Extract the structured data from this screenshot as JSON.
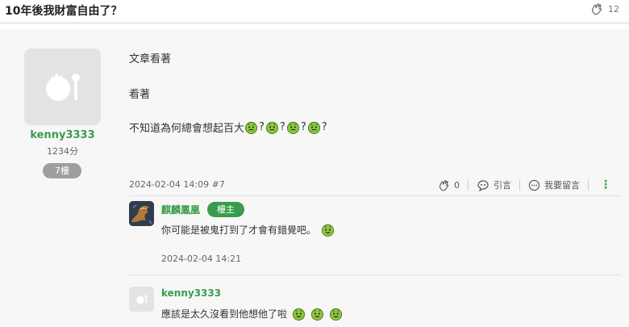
{
  "header": {
    "title": "10年後我財富自由了？",
    "like_count": "12"
  },
  "post": {
    "author": {
      "name": "kenny3333",
      "points": "1234分",
      "floor": "7樓"
    },
    "lines": {
      "line1": "文章看著",
      "line2": "看著",
      "line3": "不知道為何總會想起百大",
      "qmark": "?"
    },
    "date": "2024-02-04 14:09 #7",
    "actions": {
      "like_count": "0",
      "quote_label": "引言",
      "comment_label": "我要留言"
    }
  },
  "comments": [
    {
      "name": "麒麟鳳凰",
      "op_badge": "樓主",
      "text": "你可能是被鬼打到了才會有錯覺吧。",
      "time": "2024-02-04 14:21"
    },
    {
      "name": "kenny3333",
      "text": "應該是太久沒看到他想他了啦"
    }
  ],
  "colors": {
    "accent": "#3a9b4d",
    "badge_gray": "#9e9e9e",
    "content_bg": "#f7f7f7"
  },
  "icons": [
    "clap-icon",
    "quote-icon",
    "comment-icon",
    "more-vertical-icon",
    "avatar-placeholder-icon",
    "emoji-green-face-icon"
  ]
}
